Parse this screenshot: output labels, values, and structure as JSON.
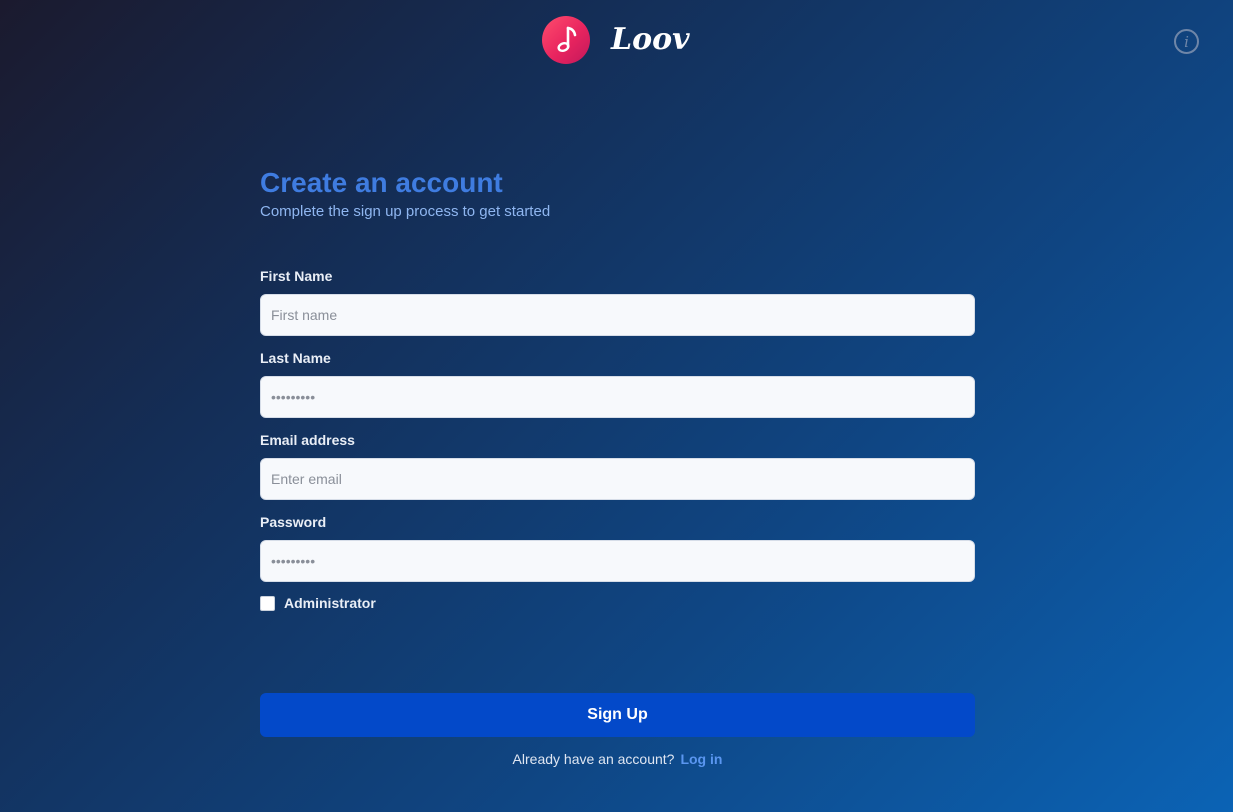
{
  "header": {
    "brand": "Loov",
    "logo_icon": "music-note-icon",
    "info_icon": "info-icon",
    "info_glyph": "i"
  },
  "form": {
    "title": "Create an account",
    "subtitle": "Complete the sign up process to get started",
    "first_name": {
      "label": "First Name",
      "placeholder": "First name",
      "value": ""
    },
    "last_name": {
      "label": "Last Name",
      "placeholder": "•••••••••",
      "value": ""
    },
    "email": {
      "label": "Email address",
      "placeholder": "Enter email",
      "value": ""
    },
    "password": {
      "label": "Password",
      "placeholder": "•••••••••",
      "value": ""
    },
    "administrator": {
      "label": "Administrator",
      "checked": false
    },
    "submit_label": "Sign Up",
    "footer_text": "Already have an account?",
    "login_label": "Log in"
  },
  "colors": {
    "accent": "#3f7ce0",
    "button": "#0349c9",
    "logo": "#e8245f",
    "link": "#5a96f0"
  }
}
